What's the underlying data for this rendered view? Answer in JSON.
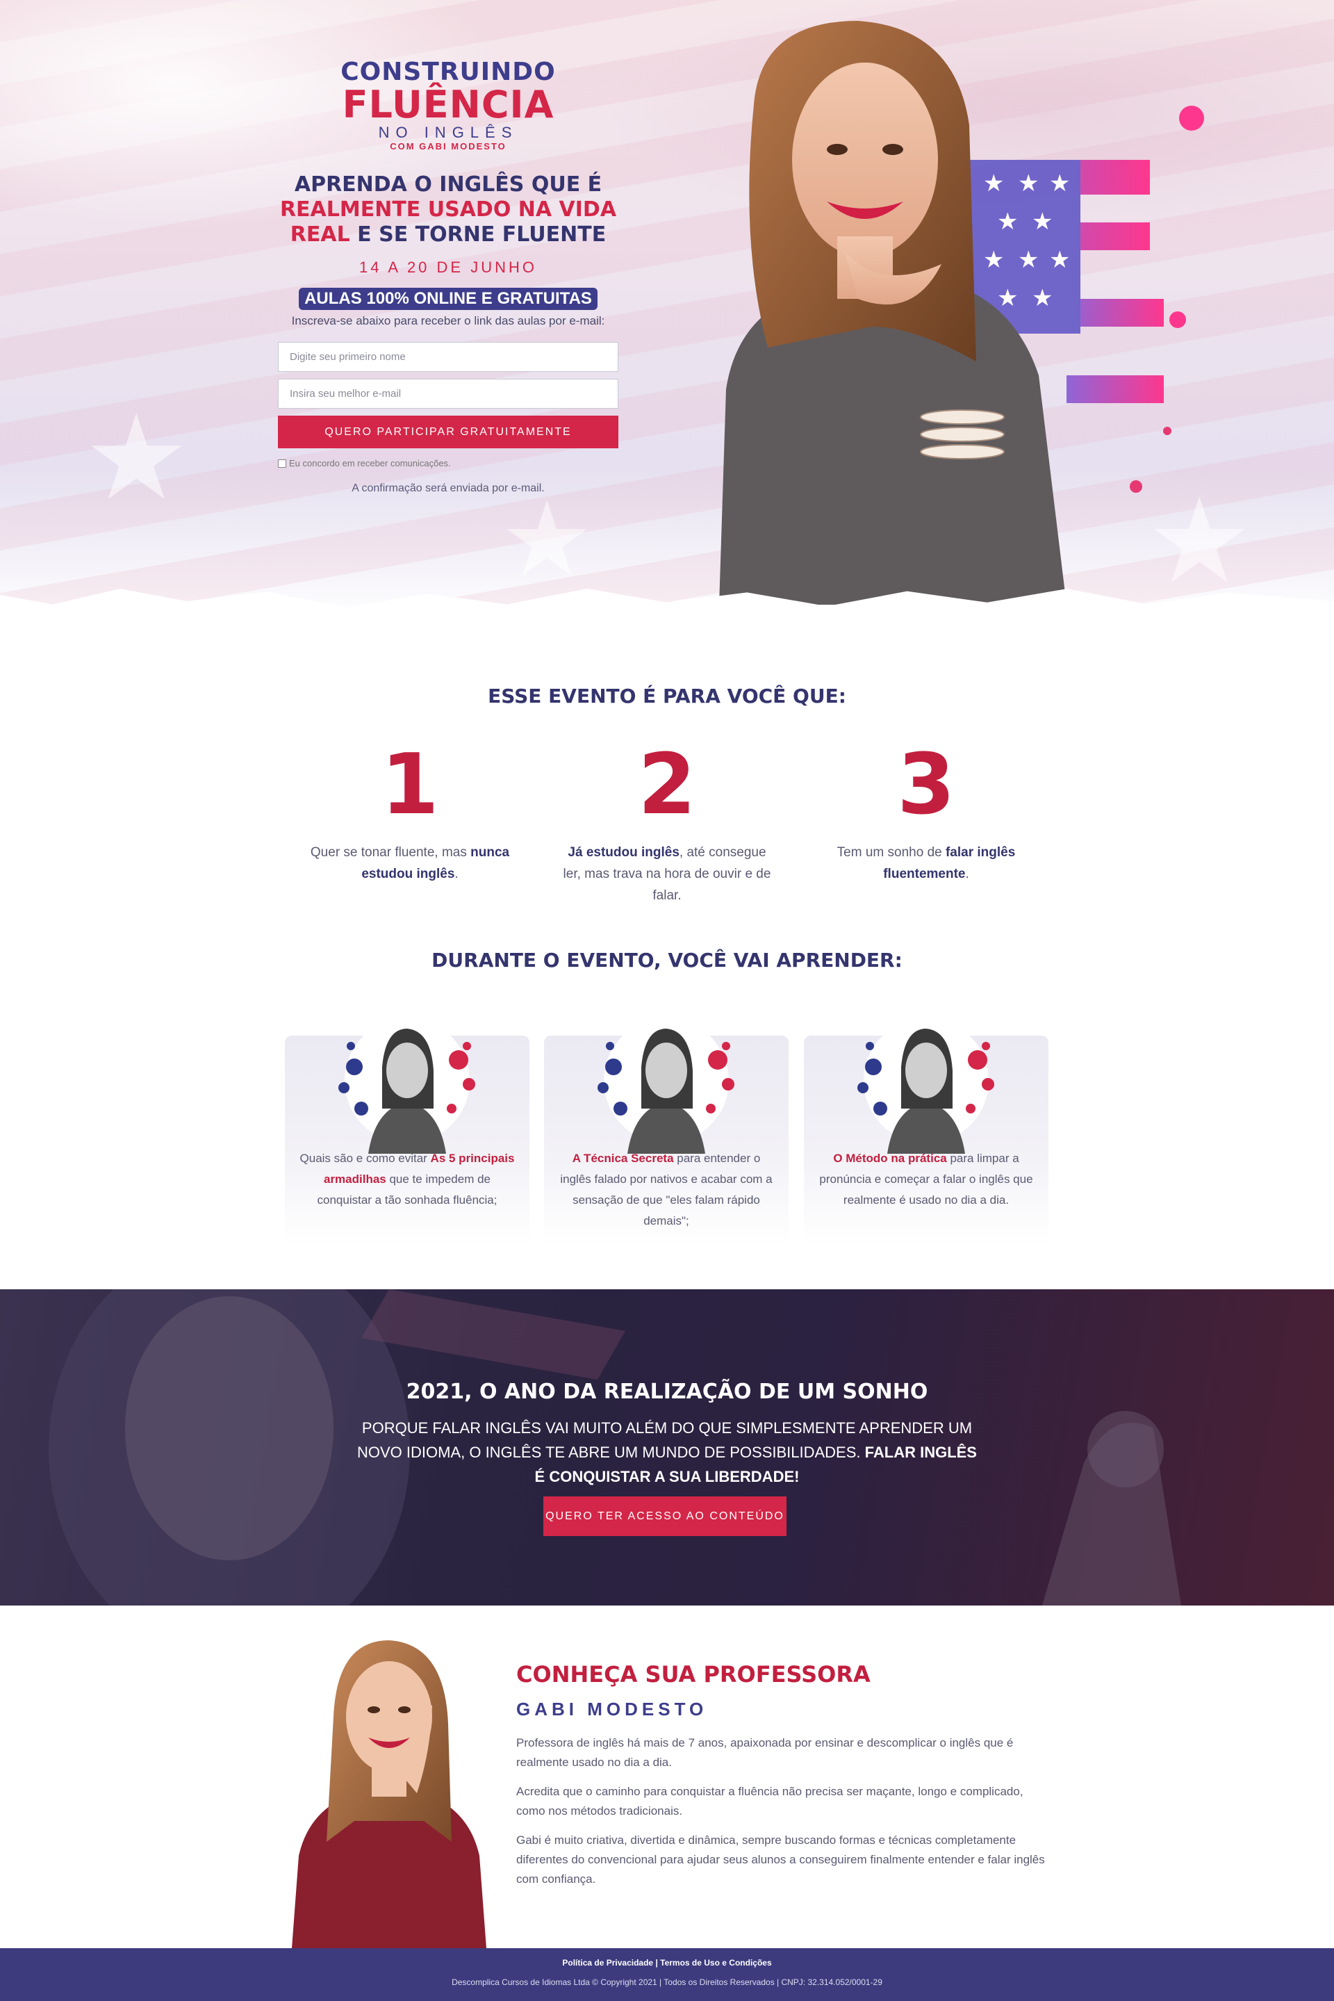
{
  "hero": {
    "logo": {
      "line1": "CONSTRUINDO",
      "line2": "FLUÊNCIA",
      "line3": "NO INGLÊS",
      "line4": "COM GABI MODESTO"
    },
    "headline_part1": "APRENDA O INGLÊS QUE É ",
    "headline_red1": "REALMENTE USADO NA VIDA",
    "headline_red2": "REAL",
    "headline_part2": " E SE TORNE FLUENTE",
    "dates": "14 A 20 DE JUNHO",
    "badge": "AULAS 100% ONLINE E GRATUITAS",
    "subscribe_text": "Inscreva-se abaixo para receber o link das aulas por e-mail:",
    "form": {
      "name_placeholder": "Digite seu primeiro nome",
      "email_placeholder": "Insira seu melhor e-mail",
      "submit_label": "QUERO PARTICIPAR GRATUITAMENTE",
      "consent_label": "Eu concordo em receber comunicações.",
      "confirmation": "A confirmação será enviada por e-mail."
    }
  },
  "event_section": {
    "title": "ESSE EVENTO É PARA VOCÊ QUE:",
    "items": [
      {
        "number": "1",
        "text_before": "Quer se tonar fluente, mas ",
        "bold": "nunca estudou inglês",
        "text_after": "."
      },
      {
        "number": "2",
        "bold": "Já estudou inglês",
        "text_after": ", até consegue ler, mas trava na hora de ouvir e de falar."
      },
      {
        "number": "3",
        "text_before": "Tem um sonho de ",
        "bold": "falar inglês fluentemente",
        "text_after": "."
      }
    ]
  },
  "learn_section": {
    "title": "DURANTE O EVENTO, VOCÊ VAI APRENDER:",
    "cards": [
      {
        "text_before": "Quais são e como evitar ",
        "highlight": "As 5 principais armadilhas",
        "text_after": " que te impedem de conquistar a tão sonhada fluência;"
      },
      {
        "highlight": "A Técnica Secreta",
        "text_after": " para entender o inglês falado por nativos e acabar com a sensação de que \"eles falam rápido demais\";"
      },
      {
        "highlight": "O Método na prática",
        "text_after": " para limpar a pronúncia e começar a falar o inglês que realmente é usado no dia a dia."
      }
    ]
  },
  "banner": {
    "title": "2021, O ANO DA REALIZAÇÃO DE UM SONHO",
    "text": "PORQUE FALAR INGLÊS VAI MUITO ALÉM DO QUE SIMPLESMENTE APRENDER UM NOVO IDIOMA, O INGLÊS TE ABRE UM MUNDO DE POSSIBILIDADES. ",
    "text_bold": "FALAR INGLÊS É CONQUISTAR A SUA LIBERDADE!",
    "button": "QUERO TER ACESSO AO CONTEÚDO"
  },
  "professor": {
    "title": "CONHEÇA SUA PROFESSORA",
    "name": "GABI MODESTO",
    "paragraphs": [
      "Professora de inglês há mais de 7 anos, apaixonada por ensinar e descomplicar o inglês que é realmente usado no dia a dia.",
      "Acredita que o caminho para conquistar a fluência não precisa ser maçante, longo e complicado, como nos métodos tradicionais.",
      "Gabi é muito criativa, divertida e dinâmica, sempre buscando formas e técnicas completamente diferentes do convencional para ajudar seus alunos a conseguirem finalmente entender e falar inglês com confiança."
    ]
  },
  "footer": {
    "privacy": "Política de Privacidade",
    "separator": " | ",
    "terms": "Termos de Uso e Condições",
    "copyright": "Descomplica Cursos de Idiomas Ltda © Copyright 2021 | Todos os Direitos Reservados | CNPJ: 32.314.052/0001-29"
  },
  "colors": {
    "red": "#d42648",
    "navy": "#3d3d8c",
    "footer": "#3d3b7e"
  }
}
